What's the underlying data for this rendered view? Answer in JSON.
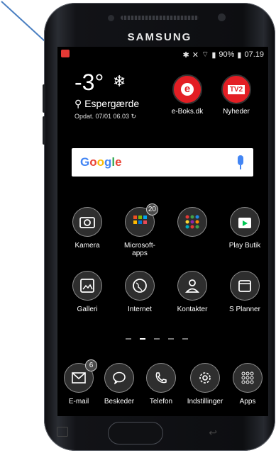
{
  "status": {
    "right_text": "90%",
    "time": "07.19",
    "accent": "#e53935"
  },
  "weather": {
    "temperature": "-3°",
    "city": "Espergærde",
    "updated": "Opdat. 07/01 06.03"
  },
  "top_apps": [
    {
      "label": "e-Boks.dk",
      "icon": "e-icon",
      "color": "#e31e24"
    },
    {
      "label": "Nyheder",
      "icon": "tv2-icon",
      "color": "#e31e24"
    }
  ],
  "search": {
    "text": "Google"
  },
  "apps": [
    {
      "label": "Kamera",
      "icon": "camera-icon"
    },
    {
      "label": "Microsoft-apps",
      "icon": "folder-icon",
      "badge": "20"
    },
    {
      "label": "",
      "icon": "folder-icon-2"
    },
    {
      "label": "Play Butik",
      "icon": "play-store-icon"
    },
    {
      "label": "Galleri",
      "icon": "gallery-icon"
    },
    {
      "label": "Internet",
      "icon": "globe-icon"
    },
    {
      "label": "Kontakter",
      "icon": "contacts-icon"
    },
    {
      "label": "S Planner",
      "icon": "calendar-icon"
    }
  ],
  "dock": [
    {
      "label": "E-mail",
      "icon": "mail-icon",
      "badge": "6"
    },
    {
      "label": "Beskeder",
      "icon": "message-icon"
    },
    {
      "label": "Telefon",
      "icon": "phone-icon"
    },
    {
      "label": "Indstillinger",
      "icon": "gear-icon"
    },
    {
      "label": "Apps",
      "icon": "apps-grid-icon"
    }
  ],
  "phone": {
    "brand": "SAMSUNG"
  }
}
